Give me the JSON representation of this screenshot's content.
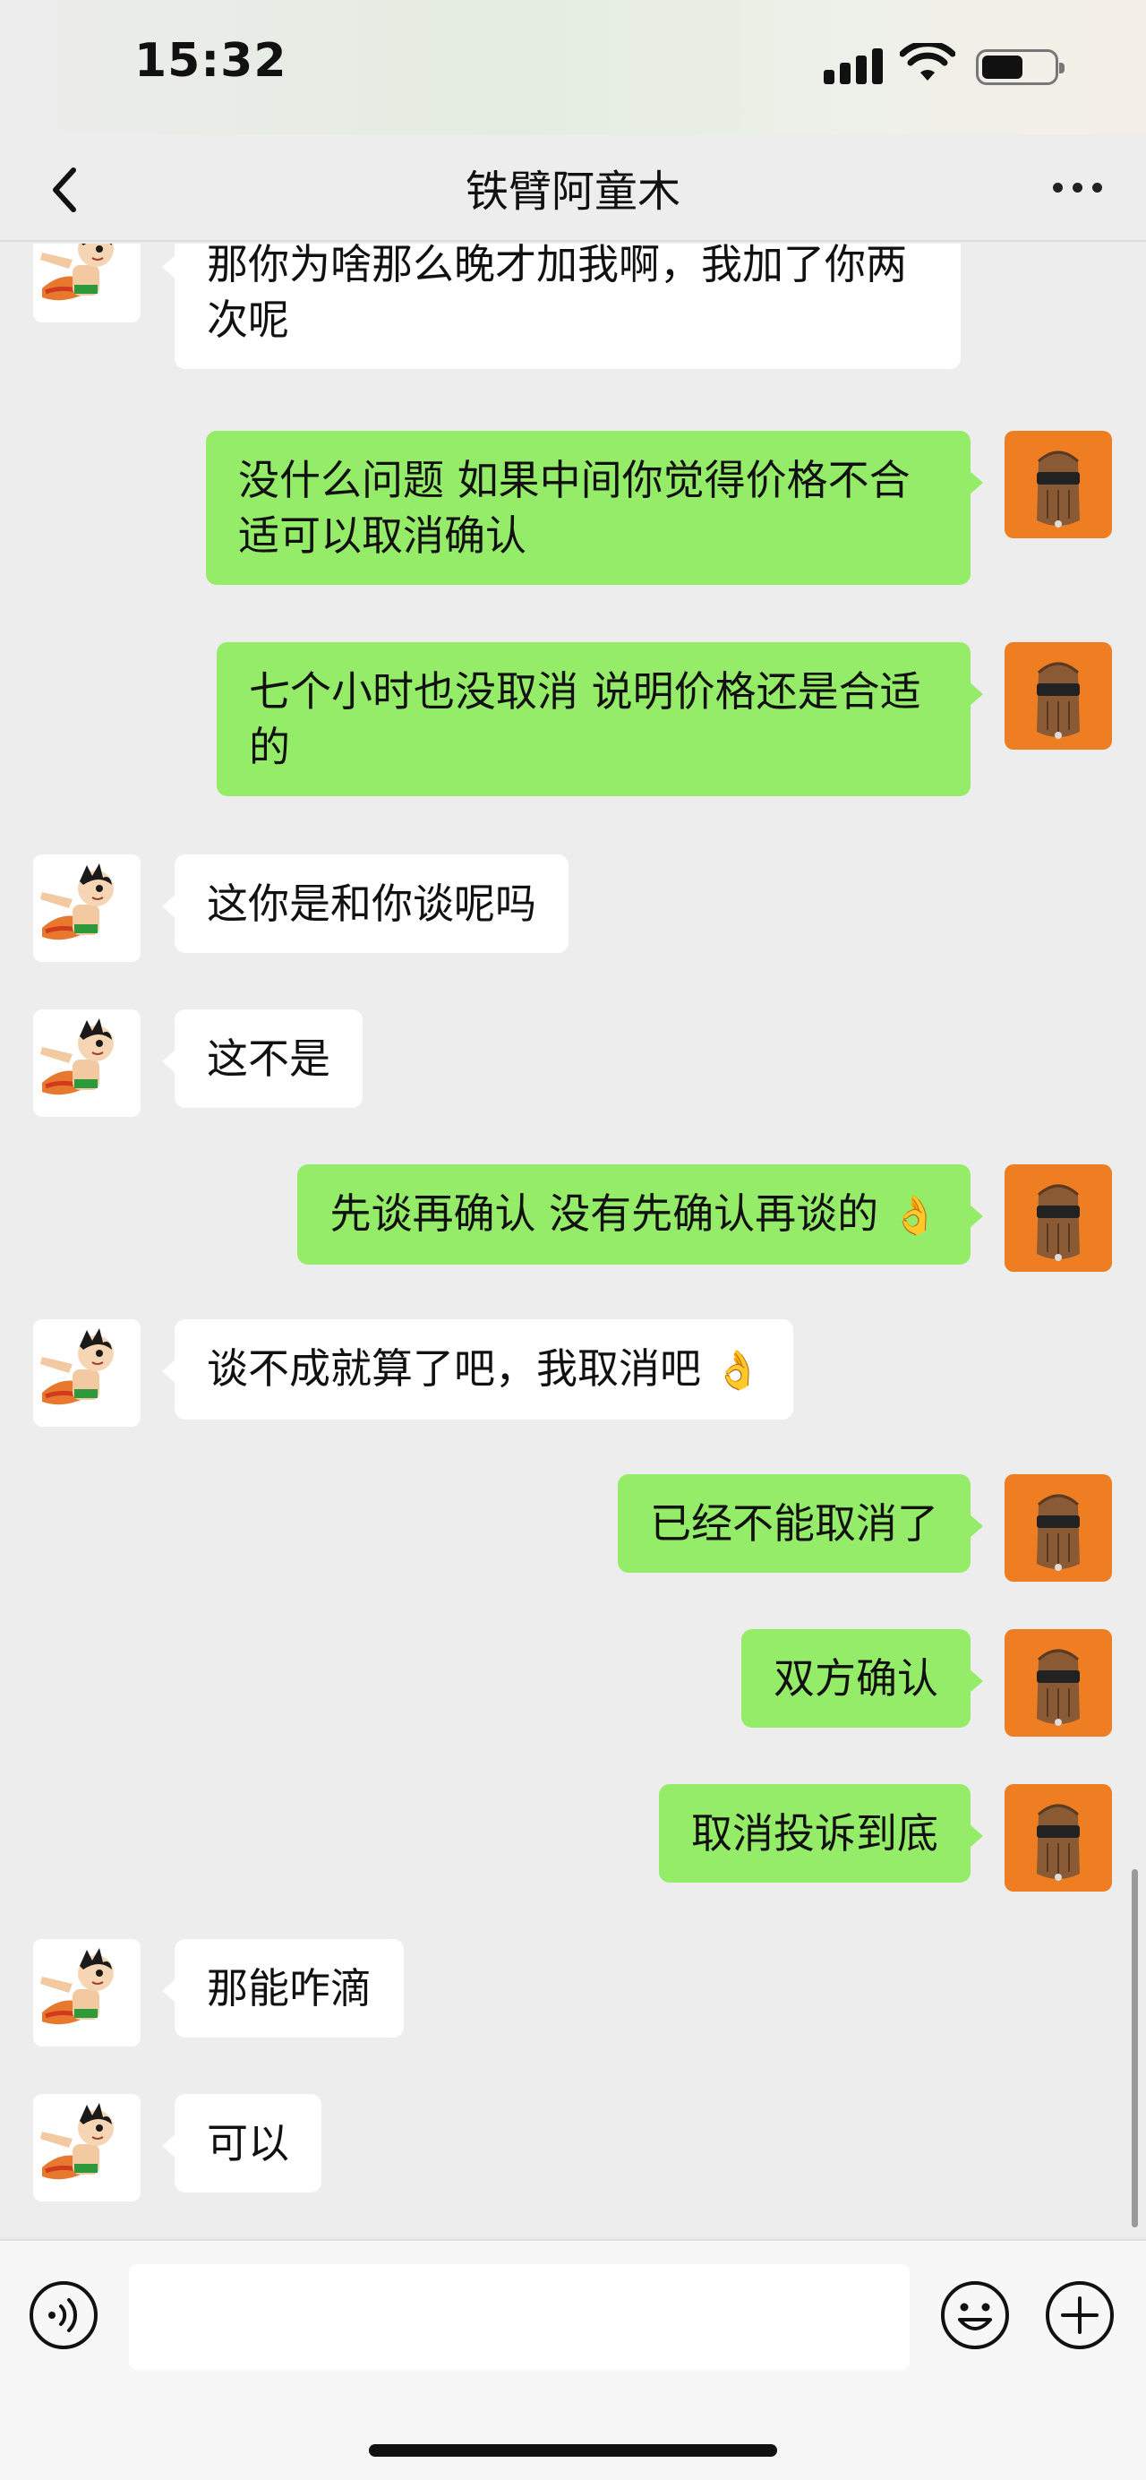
{
  "status": {
    "time": "15:32",
    "battery_level": 0.58
  },
  "header": {
    "title": "铁臂阿童木"
  },
  "messages": [
    {
      "side": "left",
      "text": "那你为啥那么晚才加我啊，我加了你两次呢"
    },
    {
      "side": "right",
      "text": "没什么问题  如果中间你觉得价格不合适可以取消确认"
    },
    {
      "side": "right",
      "text": "七个小时也没取消 说明价格还是合适的"
    },
    {
      "side": "left",
      "text": "这你是和你谈呢吗"
    },
    {
      "side": "left",
      "text": "这不是"
    },
    {
      "side": "right",
      "text": "先谈再确认 没有先确认再谈的",
      "emoji": "👌"
    },
    {
      "side": "left",
      "text": "谈不成就算了吧，我取消吧",
      "emoji": "👌"
    },
    {
      "side": "right",
      "text": "已经不能取消了"
    },
    {
      "side": "right",
      "text": "双方确认"
    },
    {
      "side": "right",
      "text": "取消投诉到底"
    },
    {
      "side": "left",
      "text": "那能咋滴"
    },
    {
      "side": "left",
      "text": "可以"
    }
  ],
  "icons": {
    "back": "chevron-left-icon",
    "more": "more-dots-icon",
    "voice": "voice-icon",
    "emoji": "smile-icon",
    "plus": "plus-icon"
  },
  "colors": {
    "sent_bubble": "#95ec69",
    "received_bubble": "#ffffff",
    "background": "#ededed"
  },
  "input": {
    "value": "",
    "placeholder": ""
  }
}
